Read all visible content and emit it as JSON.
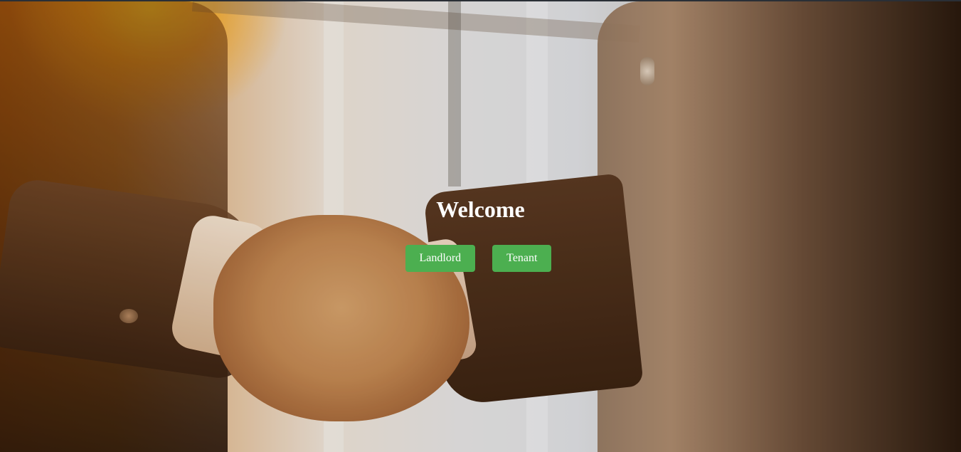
{
  "hero": {
    "title": "Welcome",
    "buttons": {
      "landlord_label": "Landlord",
      "tenant_label": "Tenant"
    },
    "colors": {
      "button_bg": "#4caf50",
      "button_text": "#ffffff",
      "title_text": "#ffffff"
    }
  }
}
